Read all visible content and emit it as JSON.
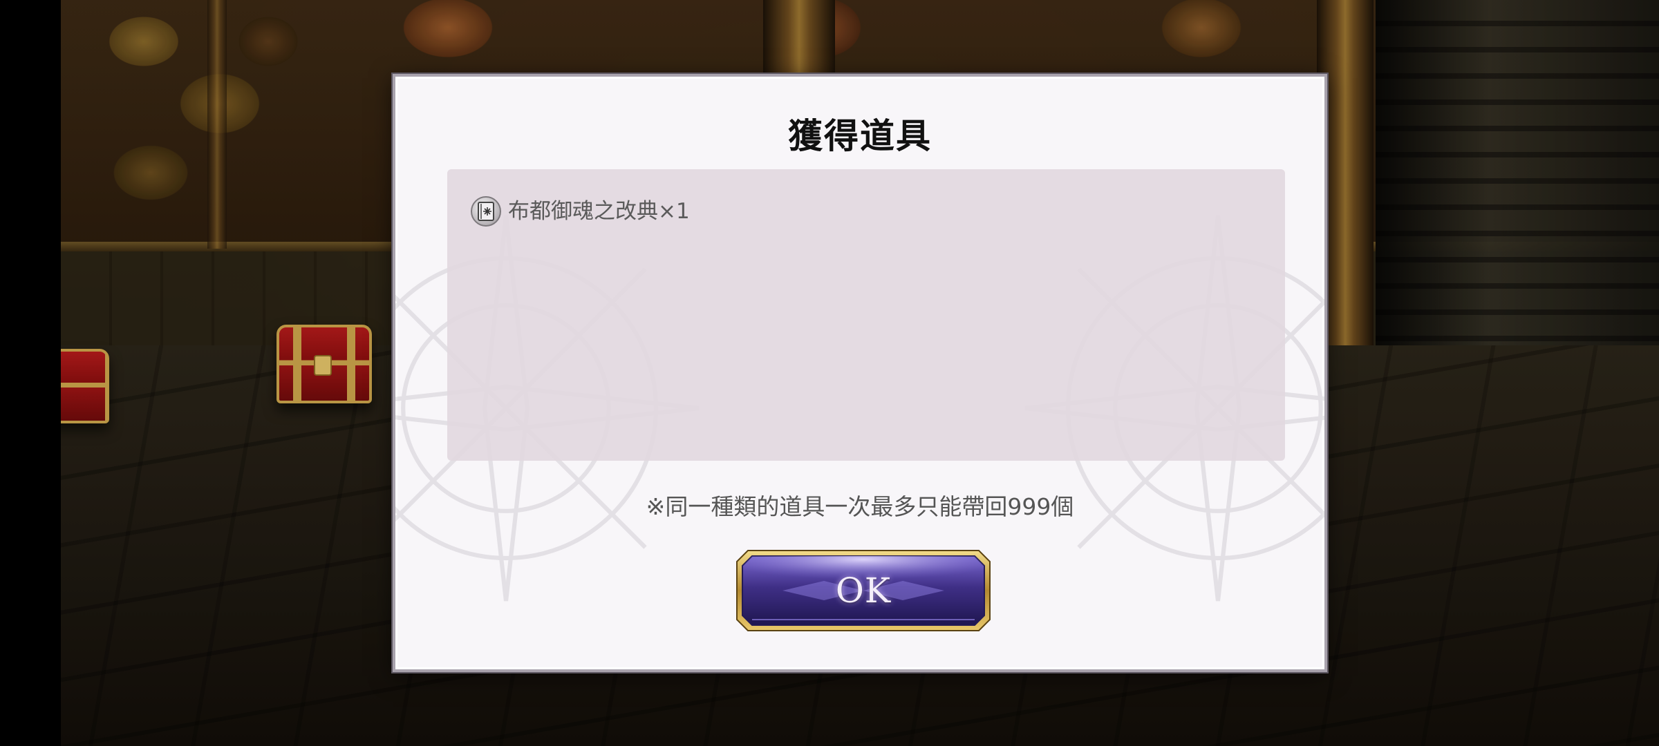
{
  "dialog": {
    "title": "獲得道具",
    "items": [
      {
        "icon": "book-icon",
        "label": "布都御魂之改典×1"
      }
    ],
    "note": "※同一種類的道具一次最多只能帶回999個",
    "ok_label": "OK"
  },
  "colors": {
    "dialog_bg": "#f8f6f9",
    "panel_bg": "#e2d8df",
    "button_gold": "#c9a24a",
    "button_purple": "#4b3a8c"
  }
}
